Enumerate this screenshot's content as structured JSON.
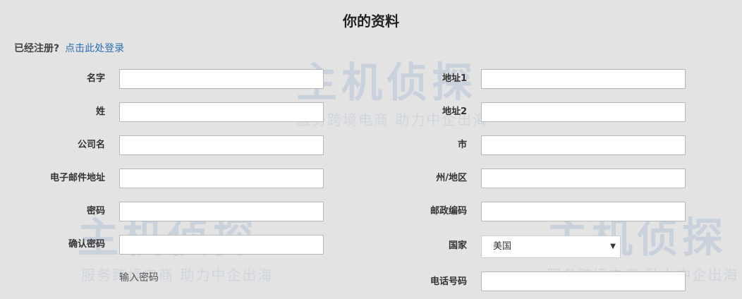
{
  "page": {
    "title": "你的资料",
    "login_prompt": "已经注册?",
    "login_link": "点击此处登录"
  },
  "form": {
    "left": [
      {
        "label": "名字",
        "value": ""
      },
      {
        "label": "姓",
        "value": ""
      },
      {
        "label": "公司名",
        "value": ""
      },
      {
        "label": "电子邮件地址",
        "value": ""
      },
      {
        "label": "密码",
        "value": ""
      },
      {
        "label": "确认密码",
        "value": ""
      }
    ],
    "right": [
      {
        "label": "地址1",
        "value": ""
      },
      {
        "label": "地址2",
        "value": ""
      },
      {
        "label": "市",
        "value": ""
      },
      {
        "label": "州/地区",
        "value": ""
      },
      {
        "label": "邮政编码",
        "value": ""
      },
      {
        "label": "国家",
        "value": "美国"
      },
      {
        "label": "电话号码",
        "value": ""
      }
    ],
    "password_helper": "输入密码",
    "dropdown_arrow": "▼"
  },
  "watermark": {
    "brand": "主机侦探",
    "tagline": "服务跨境电商 助力中企出海"
  },
  "colors": {
    "background": "#e3e3e3",
    "link": "#2a6fb4",
    "watermark": "#6c95c8"
  }
}
